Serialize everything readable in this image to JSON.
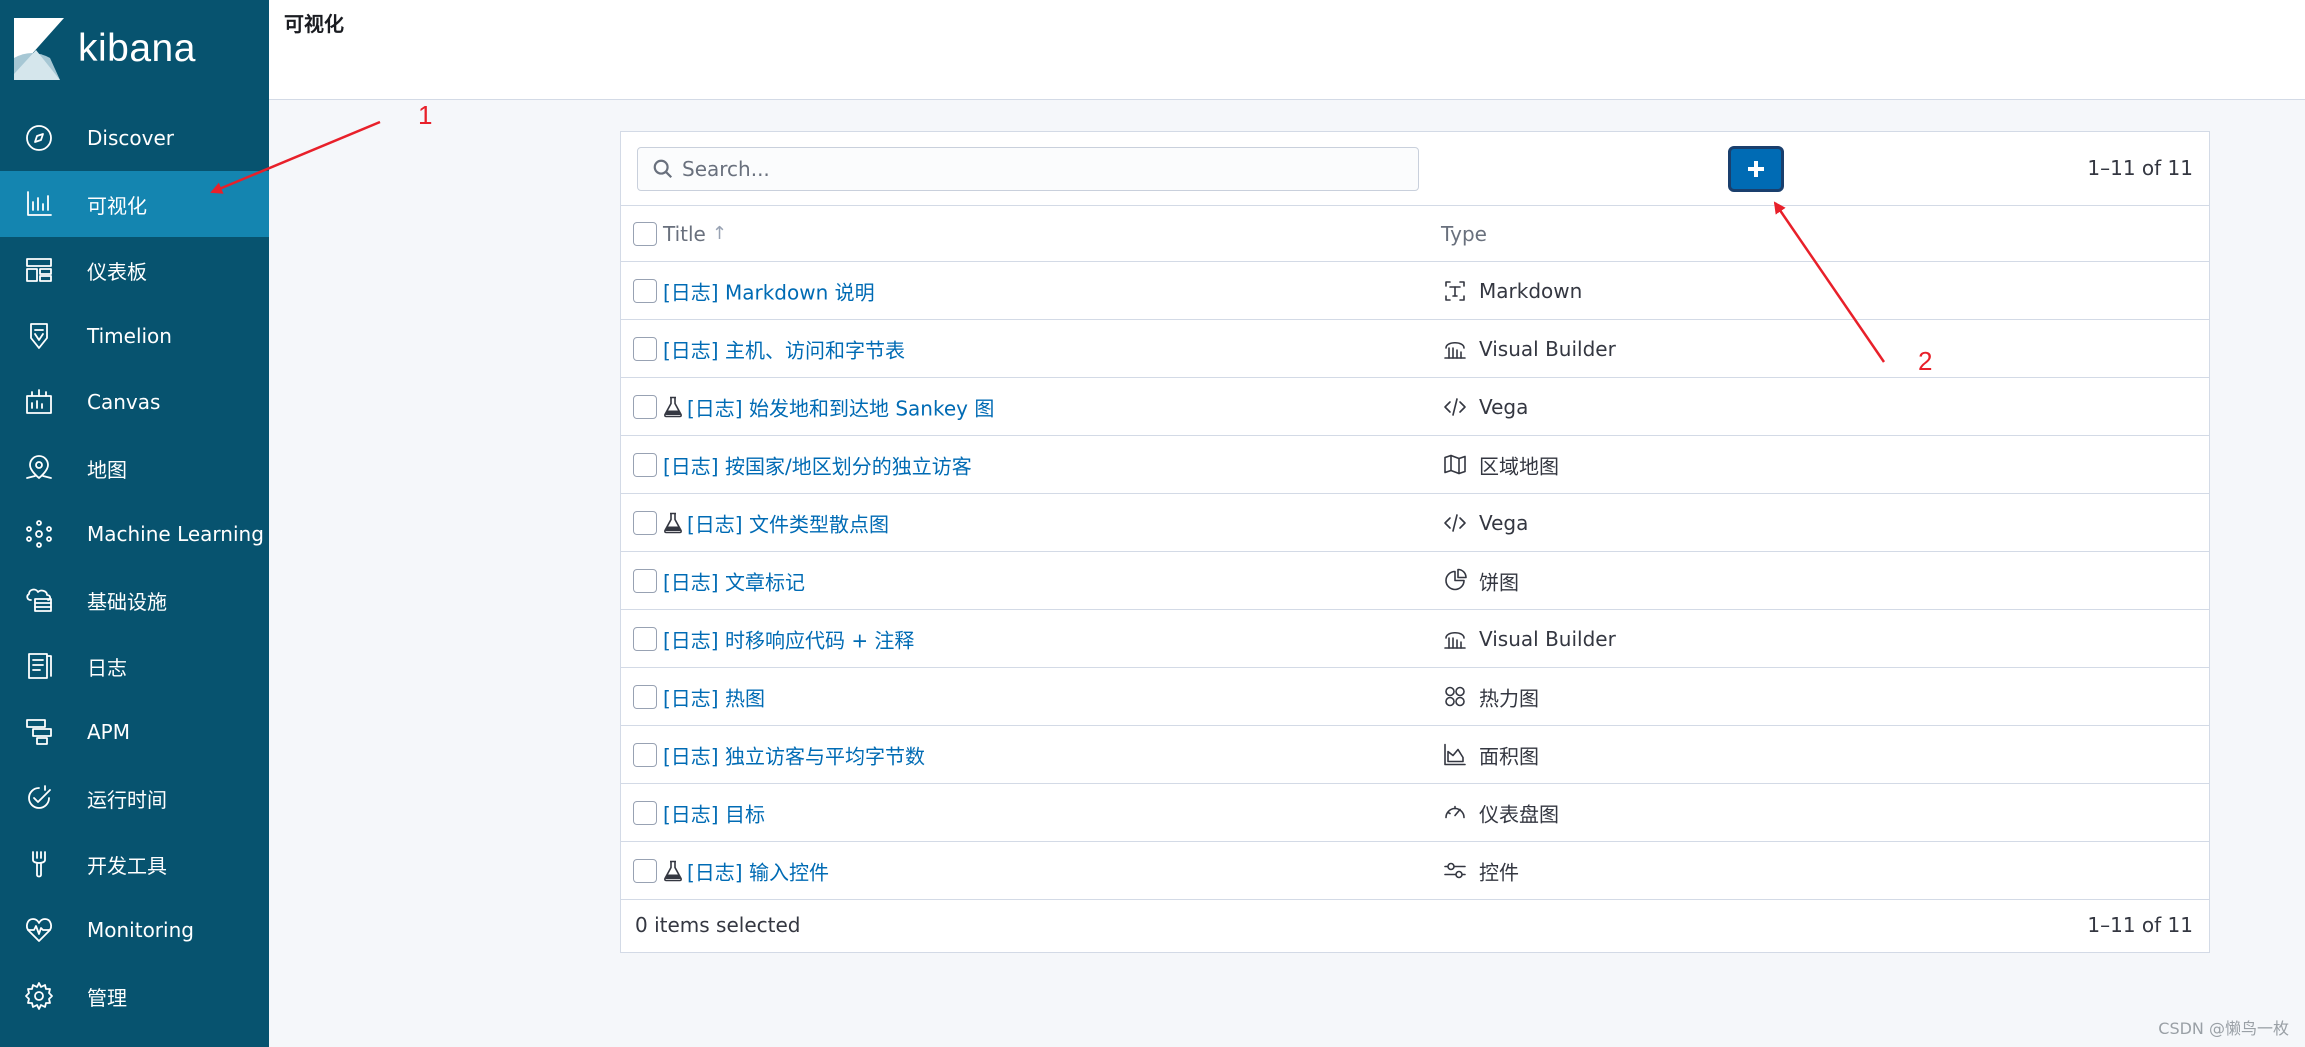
{
  "app": {
    "logo_text": "kibana"
  },
  "sidebar": {
    "items": [
      {
        "label": "Discover",
        "icon": "compass-icon",
        "active": false
      },
      {
        "label": "可视化",
        "icon": "visualize-icon",
        "active": true
      },
      {
        "label": "仪表板",
        "icon": "dashboard-icon",
        "active": false
      },
      {
        "label": "Timelion",
        "icon": "timelion-icon",
        "active": false
      },
      {
        "label": "Canvas",
        "icon": "canvas-icon",
        "active": false
      },
      {
        "label": "地图",
        "icon": "maps-icon",
        "active": false
      },
      {
        "label": "Machine Learning",
        "icon": "machine-learning-icon",
        "active": false
      },
      {
        "label": "基础设施",
        "icon": "infrastructure-icon",
        "active": false
      },
      {
        "label": "日志",
        "icon": "logs-icon",
        "active": false
      },
      {
        "label": "APM",
        "icon": "apm-icon",
        "active": false
      },
      {
        "label": "运行时间",
        "icon": "uptime-icon",
        "active": false
      },
      {
        "label": "开发工具",
        "icon": "dev-tools-icon",
        "active": false
      },
      {
        "label": "Monitoring",
        "icon": "monitoring-icon",
        "active": false
      },
      {
        "label": "管理",
        "icon": "gear-icon",
        "active": false
      }
    ]
  },
  "header": {
    "title": "可视化"
  },
  "annotations": {
    "label_1": "1",
    "label_2": "2",
    "color": "#e8202a"
  },
  "panel": {
    "search_placeholder": "Search...",
    "add_button_icon": "plus-icon",
    "count_label": "1–11 of 11",
    "columns": {
      "title": "Title",
      "type": "Type",
      "sort_icon": "sort-up-icon"
    },
    "rows": [
      {
        "title": "[日志] Markdown 说明",
        "experimental": false,
        "type": "Markdown",
        "type_icon": "markdown-icon"
      },
      {
        "title": "[日志] 主机、访问和字节表",
        "experimental": false,
        "type": "Visual Builder",
        "type_icon": "visual-builder-icon"
      },
      {
        "title": "[日志] 始发地和到达地 Sankey 图",
        "experimental": true,
        "type": "Vega",
        "type_icon": "code-icon"
      },
      {
        "title": "[日志] 按国家/地区划分的独立访客",
        "experimental": false,
        "type": "区域地图",
        "type_icon": "map-icon"
      },
      {
        "title": "[日志] 文件类型散点图",
        "experimental": true,
        "type": "Vega",
        "type_icon": "code-icon"
      },
      {
        "title": "[日志] 文章标记",
        "experimental": false,
        "type": "饼图",
        "type_icon": "pie-icon"
      },
      {
        "title": "[日志] 时移响应代码 + 注释",
        "experimental": false,
        "type": "Visual Builder",
        "type_icon": "visual-builder-icon"
      },
      {
        "title": "[日志] 热图",
        "experimental": false,
        "type": "热力图",
        "type_icon": "heatmap-icon"
      },
      {
        "title": "[日志] 独立访客与平均字节数",
        "experimental": false,
        "type": "面积图",
        "type_icon": "area-chart-icon"
      },
      {
        "title": "[日志] 目标",
        "experimental": false,
        "type": "仪表盘图",
        "type_icon": "gauge-icon"
      },
      {
        "title": "[日志] 输入控件",
        "experimental": true,
        "type": "控件",
        "type_icon": "controls-icon"
      }
    ],
    "selected_text": "0 items selected"
  },
  "watermark": "CSDN @懒鸟一枚",
  "colors": {
    "sidebar_bg": "#07536f",
    "sidebar_active": "#1485b0",
    "link": "#006bb4",
    "primary_button": "#006bb4"
  }
}
